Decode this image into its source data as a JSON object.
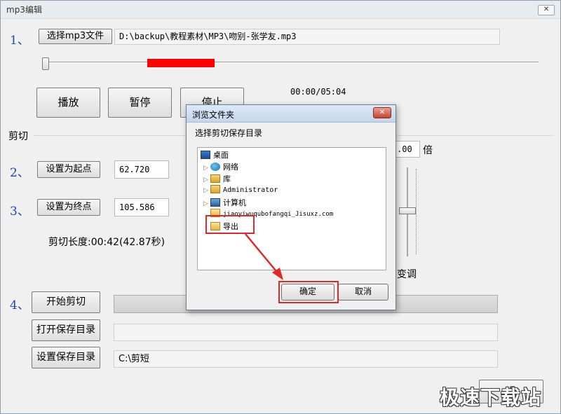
{
  "window": {
    "title": "mp3编辑",
    "close_glyph": "✕"
  },
  "file": {
    "step": "1、",
    "button": "选择mp3文件",
    "path": "D:\\backup\\教程素材\\MP3\\吻别-张学友.mp3"
  },
  "playback": {
    "position_fraction": 0.0,
    "selection_start_fraction": 0.2075,
    "selection_end_fraction": 0.3442,
    "selection_color": "#ff0000",
    "play": "播放",
    "pause": "暂停",
    "stop": "停止",
    "time": "00:00/05:04"
  },
  "cut": {
    "section_label": "剪切",
    "step2": "2、",
    "set_start": "设置为起点",
    "start_value": "62.720",
    "step3": "3、",
    "set_end": "设置为终点",
    "end_value": "105.586",
    "length_label": "剪切长度:00:42(42.87秒)",
    "speed_partial": ".00",
    "speed_unit": "倍",
    "pitch_label": "变调",
    "step4": "4、",
    "start_cut": "开始剪切",
    "open_dir": "打开保存目录",
    "set_dir": "设置保存目录",
    "save_dir": "C:\\剪短",
    "bottom_button_partial": "退"
  },
  "dialog": {
    "title": "浏览文件夹",
    "close_glyph": "✕",
    "description": "选择剪切保存目录",
    "tree": {
      "root": "桌面",
      "items": [
        "网络",
        "库",
        "Administrator",
        "计算机",
        "jiaoyiwuqubofangqi_Jisuxz.com",
        "导出"
      ]
    },
    "ok": "确定",
    "cancel": "取消"
  },
  "watermark": "极速下载站",
  "colors": {
    "accent": "#2346b0",
    "highlight_box": "#e0282a",
    "selection": "#ff0000"
  }
}
